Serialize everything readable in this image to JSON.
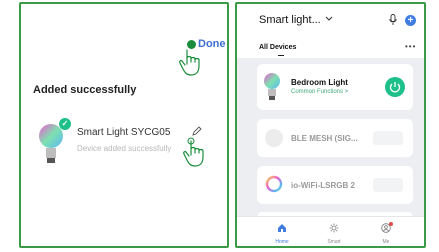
{
  "left": {
    "done_label": "Done",
    "title": "Added successfully",
    "device": {
      "name": "Smart Light SYCG05",
      "status": "Device added successfully"
    }
  },
  "right": {
    "header": {
      "home_name": "Smart light..."
    },
    "tabs": {
      "active": "All Devices",
      "more": "•••"
    },
    "devices": [
      {
        "name": "Bedroom Light",
        "sub": "Common Functions >",
        "online": true
      },
      {
        "name": "BLE MESH (SIG...",
        "online": false
      },
      {
        "name": "io-WiFi-LSRGB 2",
        "online": false
      }
    ],
    "tabbar": {
      "items": [
        {
          "label": "Home",
          "icon": "home-icon",
          "active": true
        },
        {
          "label": "Smart",
          "icon": "sun-icon",
          "active": false
        },
        {
          "label": "Me",
          "icon": "user-icon",
          "active": false
        }
      ]
    }
  },
  "colors": {
    "border": "#3a9a46",
    "accent_blue": "#3f7de0",
    "accent_green": "#1ec08a"
  }
}
